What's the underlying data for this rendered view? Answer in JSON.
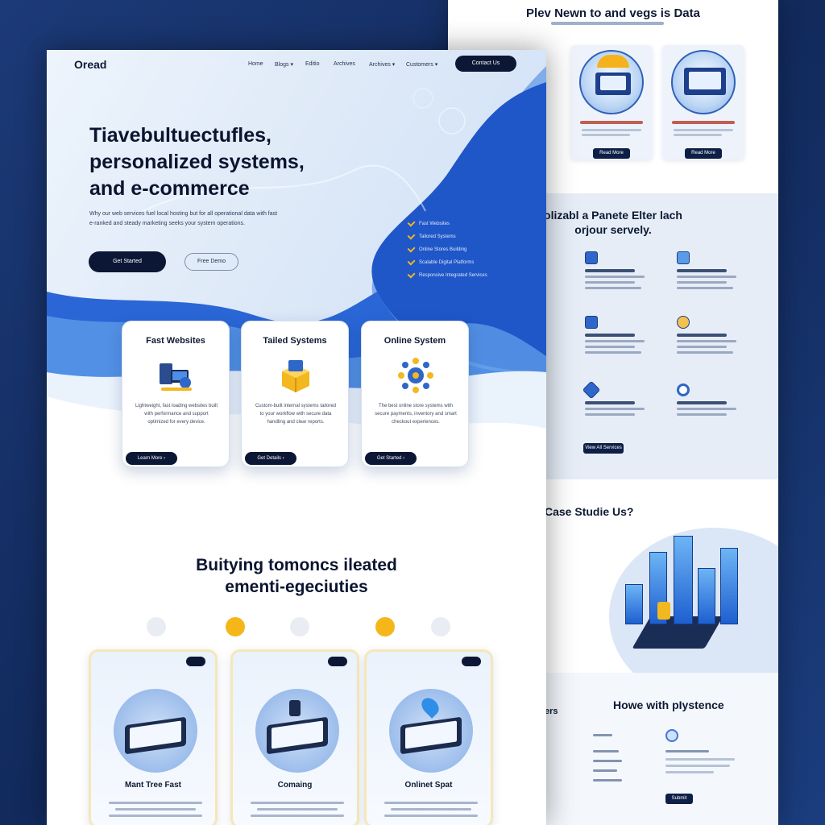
{
  "right": {
    "title": "Plev Newn to and vegs is Data",
    "cards": [
      {
        "btn": "Read More"
      },
      {
        "btn": "Read More"
      }
    ],
    "band_title_1": "olizabl a Panete Elter lach",
    "band_title_2": "orjour servely.",
    "band_btn": "View All Services",
    "case_title": "Case Studie Us?",
    "foot_title": "Howe with pIystence",
    "foot_cut": "ers",
    "foot_btn": "Submit"
  },
  "nav": {
    "logo": "Oread",
    "items": [
      "Home",
      "Blogs ▾",
      "Editio",
      "Archives",
      "Archives ▾",
      "Customers ▾"
    ],
    "cta": "Contact Us"
  },
  "hero": {
    "headline_1": "Tiavebultuectufles,",
    "headline_2": "personalized systems,",
    "headline_3": "and e-commerce",
    "lede": "Why our web services fuel local hosting but for all operational data with fast e-ranked and steady marketing seeks your system operations.",
    "primary_btn": "Get Started",
    "ghost_btn": "Free Demo",
    "checklist": [
      "Fast Websites",
      "Tailored Systems",
      "Online Stores Building",
      "Scalable Digital Platforms",
      "Responsive Integrated Services"
    ]
  },
  "services": [
    {
      "title": "Fast Websites",
      "desc": "Lightweight, fast loading websites built with performance and support optimized for every device.",
      "btn": "Learn More ›"
    },
    {
      "title": "Tailed Systems",
      "desc": "Custom-built internal systems tailored to your workflow with secure data handling and clear reports.",
      "btn": "Get Details ›"
    },
    {
      "title": "Online System",
      "desc": "The best online store systems with secure payments, inventory and smart checkout experiences.",
      "btn": "Get Started ›"
    }
  ],
  "section2": {
    "title_1": "Buitying tomoncs ileated",
    "title_2": "ementi-egeciuties",
    "cards": [
      {
        "name": "Mant Tree Fast"
      },
      {
        "name": "Comaing"
      },
      {
        "name": "Onlinet Spat"
      }
    ]
  },
  "colors": {
    "navy": "#0b1734",
    "blue": "#1f56c8",
    "accent": "#f3b71f"
  }
}
